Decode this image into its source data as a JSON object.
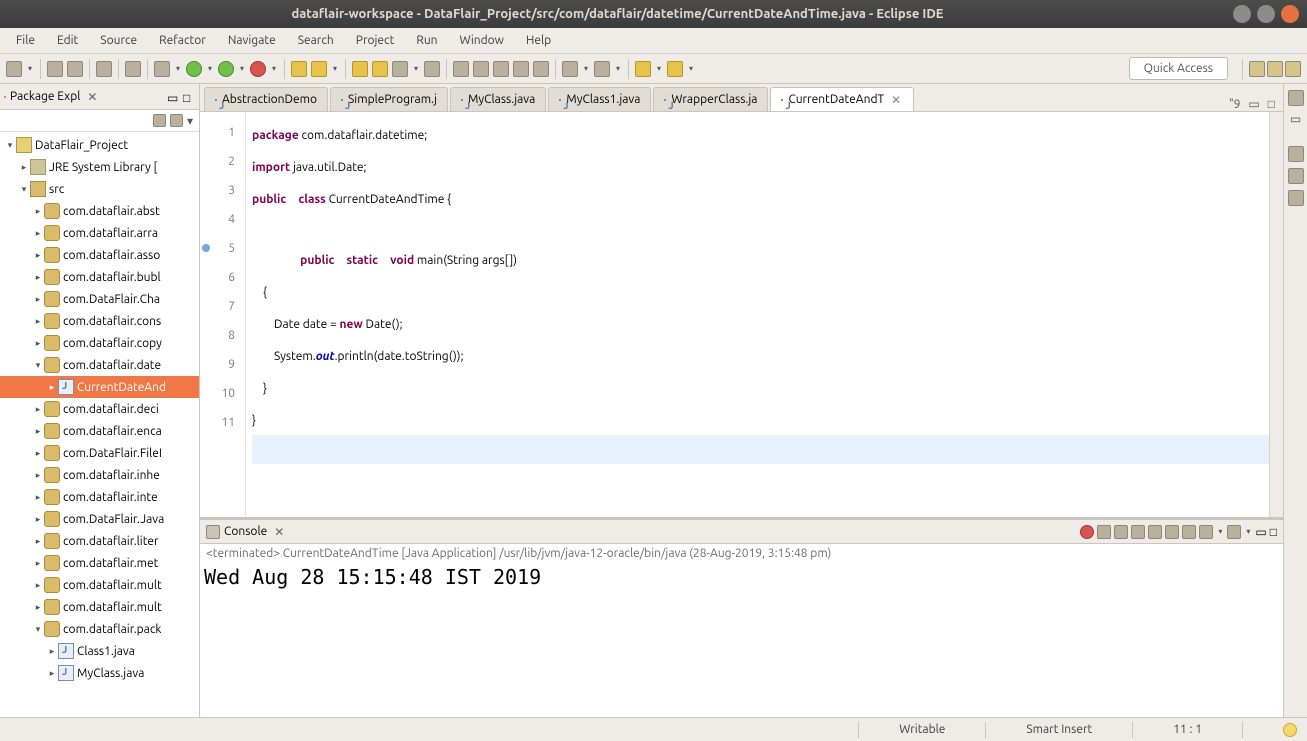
{
  "title": "dataflair-workspace - DataFlair_Project/src/com/dataflair/datetime/CurrentDateAndTime.java - Eclipse IDE",
  "menus": [
    "File",
    "Edit",
    "Source",
    "Refactor",
    "Navigate",
    "Search",
    "Project",
    "Run",
    "Window",
    "Help"
  ],
  "quick_access": "Quick Access",
  "pex": {
    "title": "Package Expl",
    "project": "DataFlair_Project",
    "jre": "JRE System Library [",
    "src": "src",
    "pkgs": [
      "com.dataflair.abst",
      "com.dataflair.arra",
      "com.dataflair.asso",
      "com.dataflair.bubl",
      "com.DataFlair.Cha",
      "com.dataflair.cons",
      "com.dataflair.copy",
      "com.dataflair.date",
      "com.dataflair.deci",
      "com.dataflair.enca",
      "com.DataFlair.FileI",
      "com.dataflair.inhe",
      "com.dataflair.inte",
      "com.DataFlair.Java",
      "com.dataflair.liter",
      "com.dataflair.met",
      "com.dataflair.mult",
      "com.dataflair.mult",
      "com.dataflair.pack"
    ],
    "sel_file": "CurrentDateAnd",
    "pack_children": [
      "Class1.java",
      "MyClass.java"
    ]
  },
  "tabs": [
    "AbstractionDemo",
    "SimpleProgram.j",
    "MyClass.java",
    "MyClass1.java",
    "WrapperClass.ja",
    "CurrentDateAndT"
  ],
  "tabs_overflow": "\"9",
  "code_tokens": {
    "l1a": "package",
    "l1b": " com.dataflair.datetime;",
    "l2a": "import",
    "l2b": " java.util.Date;",
    "l3a": "public",
    "l3b": "class",
    "l3c": " CurrentDateAndTime {",
    "l5a": "public",
    "l5b": "static",
    "l5c": "void",
    "l5d": " main(String args[])",
    "l6": "    {",
    "l7a": "        Date date = ",
    "l7b": "new",
    "l7c": " Date();",
    "l8a": "        System.",
    "l8b": "out",
    "l8c": ".println(date.toString());",
    "l9": "    }",
    "l10": "}"
  },
  "gutter": [
    "1",
    "2",
    "3",
    "4",
    "5",
    "6",
    "7",
    "8",
    "9",
    "10",
    "11"
  ],
  "console": {
    "title": "Console",
    "info": "<terminated> CurrentDateAndTime [Java Application] /usr/lib/jvm/java-12-oracle/bin/java (28-Aug-2019, 3:15:48 pm)",
    "out": "Wed Aug 28 15:15:48 IST 2019"
  },
  "status": {
    "writable": "Writable",
    "insert": "Smart Insert",
    "pos": "11 : 1"
  }
}
